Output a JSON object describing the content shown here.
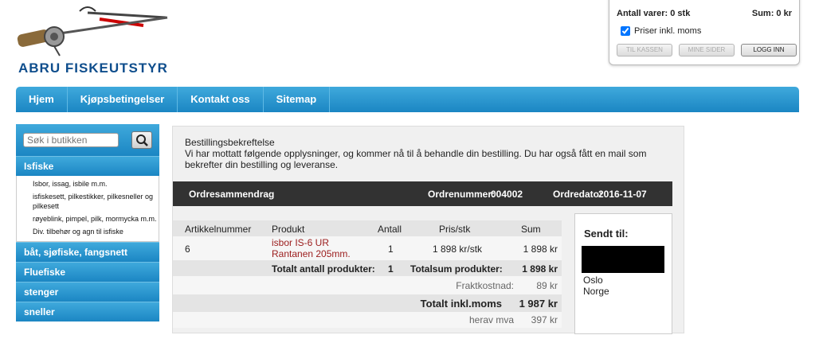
{
  "logo": {
    "text": "ABRU FISKEUTSTYR"
  },
  "cart": {
    "items_label": "Antall varer: 0 stk",
    "sum_label": "Sum: 0 kr",
    "prices_checkbox_label": "Priser inkl. moms",
    "buttons": [
      "TIL KASSEN",
      "MINE SIDER",
      "LOGG INN"
    ]
  },
  "nav": [
    "Hjem",
    "Kjøpsbetingelser",
    "Kontakt oss",
    "Sitemap"
  ],
  "sidebar": {
    "search_placeholder": "Søk i butikken",
    "active_category": "Isfiske",
    "subitems": [
      "Isbor, issag, isbile m.m.",
      "isfiskesett, pilkestikker, pilkesneller og pilkesett",
      "røyeblink, pimpel, pilk, mormycka m.m.",
      "Div. tilbehør og agn til isfiske"
    ],
    "categories": [
      "båt, sjøfiske, fangsnett",
      "Fluefiske",
      "stenger",
      "sneller"
    ]
  },
  "order": {
    "heading": "Bestillingsbekreftelse",
    "message": "Vi har mottatt følgende opplysninger, og kommer nå til å behandle din bestilling. Du har også fått en mail som bekrefter din bestilling og leveranse.",
    "summary_title": "Ordresammendrag",
    "order_number_label": "Ordrenummer:",
    "order_number": "004002",
    "order_date_label": "Ordredato:",
    "order_date": "2016-11-07",
    "columns": [
      "Artikkelnummer",
      "Produkt",
      "Antall",
      "Pris/stk",
      "Sum"
    ],
    "row": {
      "article": "6",
      "product_line1": "isbor IS-6 UR",
      "product_line2": "Rantanen 205mm.",
      "qty": "1",
      "price": "1 898 kr/stk",
      "sum": "1 898 kr"
    },
    "total_products_label": "Totalt antall produkter:",
    "total_products": "1",
    "subtotal_label": "Totalsum produkter:",
    "subtotal": "1 898 kr",
    "shipping_label": "Fraktkostnad:",
    "shipping": "89 kr",
    "total_label": "Totalt inkl.moms",
    "total": "1 987 kr",
    "vat_label": "herav mva",
    "vat": "397 kr"
  },
  "ship_to": {
    "title": "Sendt til:",
    "city": "Oslo",
    "country": "Norge"
  }
}
